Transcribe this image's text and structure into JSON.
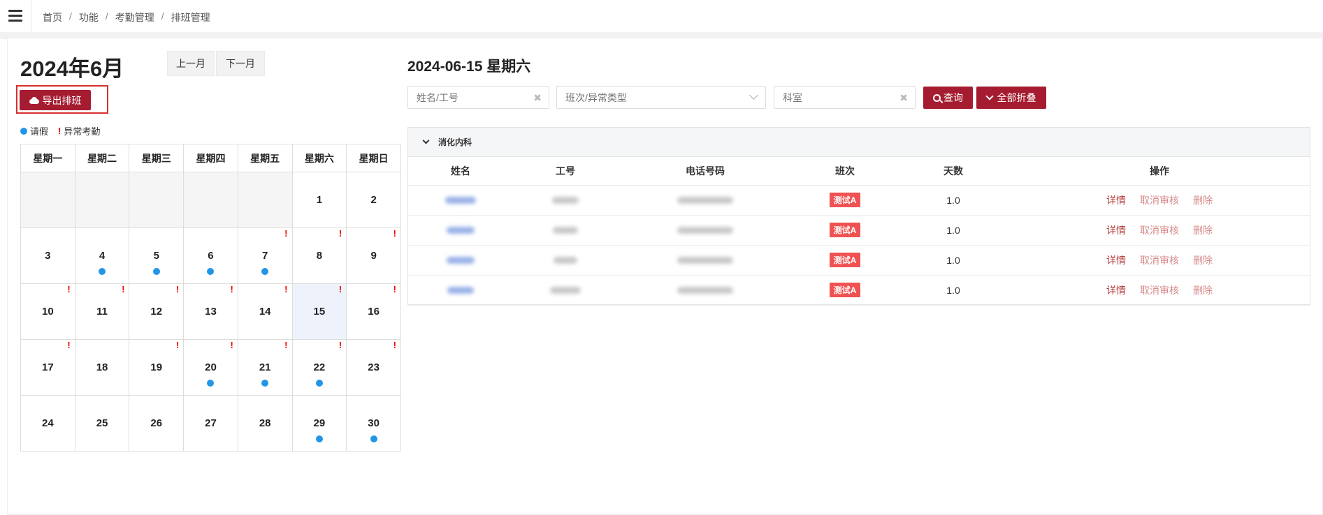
{
  "breadcrumb": [
    "首页",
    "功能",
    "考勤管理",
    "排班管理"
  ],
  "calendar": {
    "month_title": "2024年6月",
    "prev_label": "上一月",
    "next_label": "下一月",
    "export_label": "导出排班",
    "legend_leave": "请假",
    "legend_abnormal": "异常考勤",
    "legend_abnormal_mark": "!",
    "weekdays": [
      "星期一",
      "星期二",
      "星期三",
      "星期四",
      "星期五",
      "星期六",
      "星期日"
    ],
    "selected_day": 15,
    "days": [
      {
        "day": "",
        "leave": false,
        "abnormal": false
      },
      {
        "day": "",
        "leave": false,
        "abnormal": false
      },
      {
        "day": "",
        "leave": false,
        "abnormal": false
      },
      {
        "day": "",
        "leave": false,
        "abnormal": false
      },
      {
        "day": "",
        "leave": false,
        "abnormal": false
      },
      {
        "day": "1",
        "leave": false,
        "abnormal": false
      },
      {
        "day": "2",
        "leave": false,
        "abnormal": false
      },
      {
        "day": "3",
        "leave": false,
        "abnormal": false
      },
      {
        "day": "4",
        "leave": true,
        "abnormal": false
      },
      {
        "day": "5",
        "leave": true,
        "abnormal": false
      },
      {
        "day": "6",
        "leave": true,
        "abnormal": false
      },
      {
        "day": "7",
        "leave": true,
        "abnormal": true
      },
      {
        "day": "8",
        "leave": false,
        "abnormal": true
      },
      {
        "day": "9",
        "leave": false,
        "abnormal": true
      },
      {
        "day": "10",
        "leave": false,
        "abnormal": true
      },
      {
        "day": "11",
        "leave": false,
        "abnormal": true
      },
      {
        "day": "12",
        "leave": false,
        "abnormal": true
      },
      {
        "day": "13",
        "leave": false,
        "abnormal": true
      },
      {
        "day": "14",
        "leave": false,
        "abnormal": true
      },
      {
        "day": "15",
        "leave": false,
        "abnormal": true
      },
      {
        "day": "16",
        "leave": false,
        "abnormal": true
      },
      {
        "day": "17",
        "leave": false,
        "abnormal": true
      },
      {
        "day": "18",
        "leave": false,
        "abnormal": false
      },
      {
        "day": "19",
        "leave": false,
        "abnormal": true
      },
      {
        "day": "20",
        "leave": true,
        "abnormal": true
      },
      {
        "day": "21",
        "leave": true,
        "abnormal": true
      },
      {
        "day": "22",
        "leave": true,
        "abnormal": true
      },
      {
        "day": "23",
        "leave": false,
        "abnormal": true
      },
      {
        "day": "24",
        "leave": false,
        "abnormal": false
      },
      {
        "day": "25",
        "leave": false,
        "abnormal": false
      },
      {
        "day": "26",
        "leave": false,
        "abnormal": false
      },
      {
        "day": "27",
        "leave": false,
        "abnormal": false
      },
      {
        "day": "28",
        "leave": false,
        "abnormal": false
      },
      {
        "day": "29",
        "leave": true,
        "abnormal": false
      },
      {
        "day": "30",
        "leave": true,
        "abnormal": false
      }
    ]
  },
  "detail": {
    "date_title": "2024-06-15 星期六",
    "filters": {
      "name_placeholder": "姓名/工号",
      "shift_placeholder": "班次/异常类型",
      "dept_value": "科室",
      "clear_symbol": "✖"
    },
    "query_label": "查询",
    "collapse_label": "全部折叠",
    "group_name": "消化内科",
    "columns": [
      "姓名",
      "工号",
      "电话号码",
      "班次",
      "天数",
      "操作"
    ],
    "rows": [
      {
        "shift": "测试A",
        "days": "1.0"
      },
      {
        "shift": "测试A",
        "days": "1.0"
      },
      {
        "shift": "测试A",
        "days": "1.0"
      },
      {
        "shift": "测试A",
        "days": "1.0"
      }
    ],
    "actions": {
      "detail": "详情",
      "cancel": "取消审核",
      "delete": "删除"
    }
  },
  "colors": {
    "brand": "#a51c30",
    "leave": "#2196e6",
    "abnormal": "#e00000",
    "shift_tag": "#f05252"
  }
}
